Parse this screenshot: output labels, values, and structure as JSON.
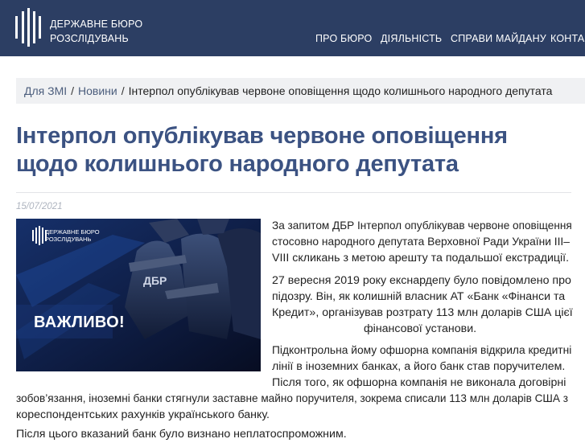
{
  "header": {
    "logo_line1": "ДЕРЖАВНЕ БЮРО",
    "logo_line2": "РОЗСЛІДУВАНЬ",
    "nav": [
      "ПРО БЮРО",
      "ДІЯЛЬНІСТЬ",
      "СПРАВИ МАЙДАНУ",
      "КОНТАКТИ"
    ],
    "background_color": "#2c3e63"
  },
  "breadcrumb": {
    "items": [
      "Для ЗМІ",
      "Новини"
    ],
    "current": "Інтерпол опублікував червоне оповіщення щодо колишнього народного депутата"
  },
  "article": {
    "title_line1": "Інтерпол опублікував червоне оповіщення",
    "title_line2": "щодо колишнього народного депутата",
    "date": "15/07/2021",
    "image": {
      "logo_line1": "ДЕРЖАВНЕ БЮРО",
      "logo_line2": "РОЗСЛІДУВАНЬ",
      "label": "ВАЖЛИВО!",
      "vest_text": "ДБР"
    },
    "p1": [
      "За запитом ДБР Інтерпол опублікував червоне оповіщення",
      "стосовно народного депутата Верховної Ради України III–",
      "VIII скликань з метою арешту та подальшої екстрадиції."
    ],
    "p2": [
      "27 вересня 2019 року екснардепу було повідомлено про",
      "підозру. Він, як колишній власник АТ «Банк «Фінанси та",
      "Кредит», організував розтрату 113 млн доларів США цієї",
      "фінансової установи."
    ],
    "p3": [
      "Підконтрольна йому офшорна компанія відкрила кредитні",
      "лінії в іноземних банках, а його банк став поручителем.",
      "Після того, як офшорна компанія не виконала договірні",
      "зобов’язання, іноземні банки стягнули заставне майно поручителя, зокрема списали 113 млн доларів США з",
      "кореспондентських рахунків українського банку."
    ],
    "p4": [
      "Після цього вказаний банк було визнано неплатоспроможним."
    ]
  }
}
